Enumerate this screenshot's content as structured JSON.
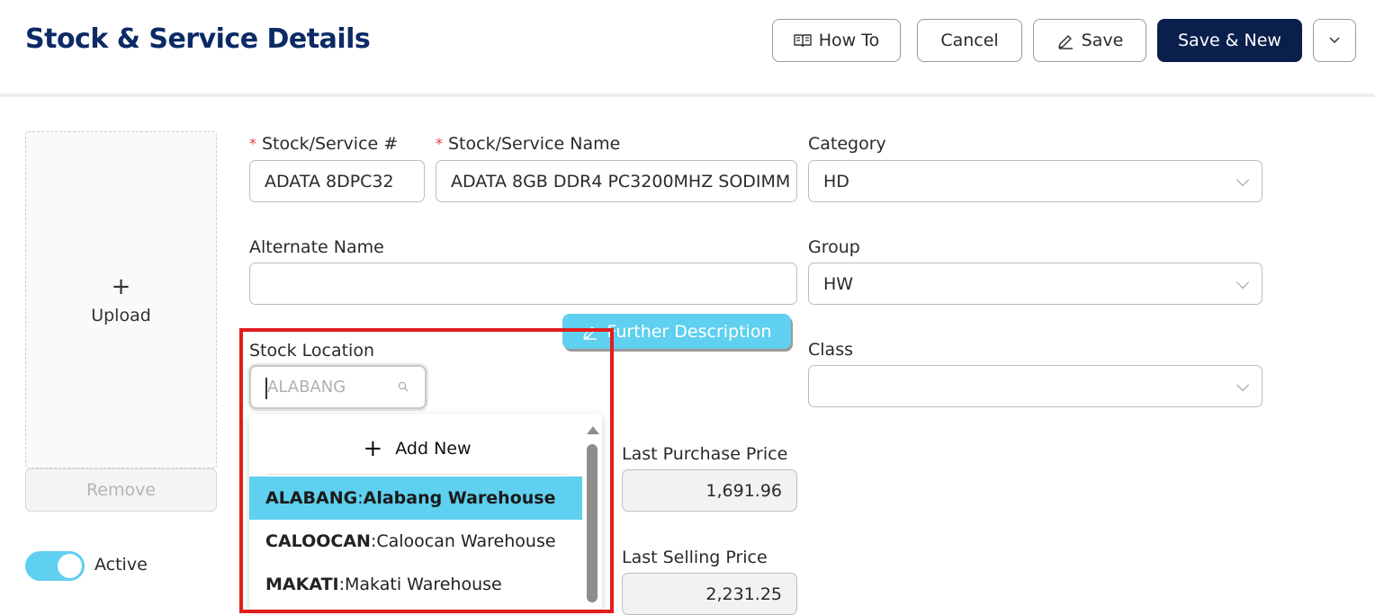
{
  "header": {
    "title": "Stock & Service Details",
    "buttons": {
      "how_to": "How To",
      "cancel": "Cancel",
      "save": "Save",
      "save_new": "Save & New"
    }
  },
  "upload": {
    "label": "Upload",
    "remove": "Remove"
  },
  "status": {
    "active_label": "Active",
    "active": true
  },
  "form": {
    "stock_number": {
      "label": "Stock/Service #",
      "value": "ADATA 8DPC32"
    },
    "stock_name": {
      "label": "Stock/Service Name",
      "value": "ADATA 8GB DDR4 PC3200MHZ SODIMM"
    },
    "category": {
      "label": "Category",
      "value": "HD"
    },
    "alternate_name": {
      "label": "Alternate Name",
      "value": ""
    },
    "group": {
      "label": "Group",
      "value": "HW"
    },
    "further_description": "Further Description",
    "class": {
      "label": "Class",
      "value": ""
    },
    "stock_location": {
      "label": "Stock Location",
      "placeholder": "ALABANG"
    },
    "last_purchase_price": {
      "label": "Last Purchase Price",
      "value": "1,691.96"
    },
    "last_selling_price": {
      "label": "Last Selling Price",
      "value": "2,231.25"
    }
  },
  "location_dropdown": {
    "add_new": "Add New",
    "options": [
      {
        "code": "ALABANG",
        "name": "Alabang Warehouse",
        "selected": true
      },
      {
        "code": "CALOOCAN",
        "name": "Caloocan Warehouse",
        "selected": false
      },
      {
        "code": "MAKATI",
        "name": "Makati Warehouse",
        "selected": false
      }
    ],
    "separator": ": "
  },
  "colors": {
    "brand": "#0b2a66",
    "accent": "#5fd0ef",
    "required": "#e0403c",
    "highlight": "#e11d1d"
  }
}
